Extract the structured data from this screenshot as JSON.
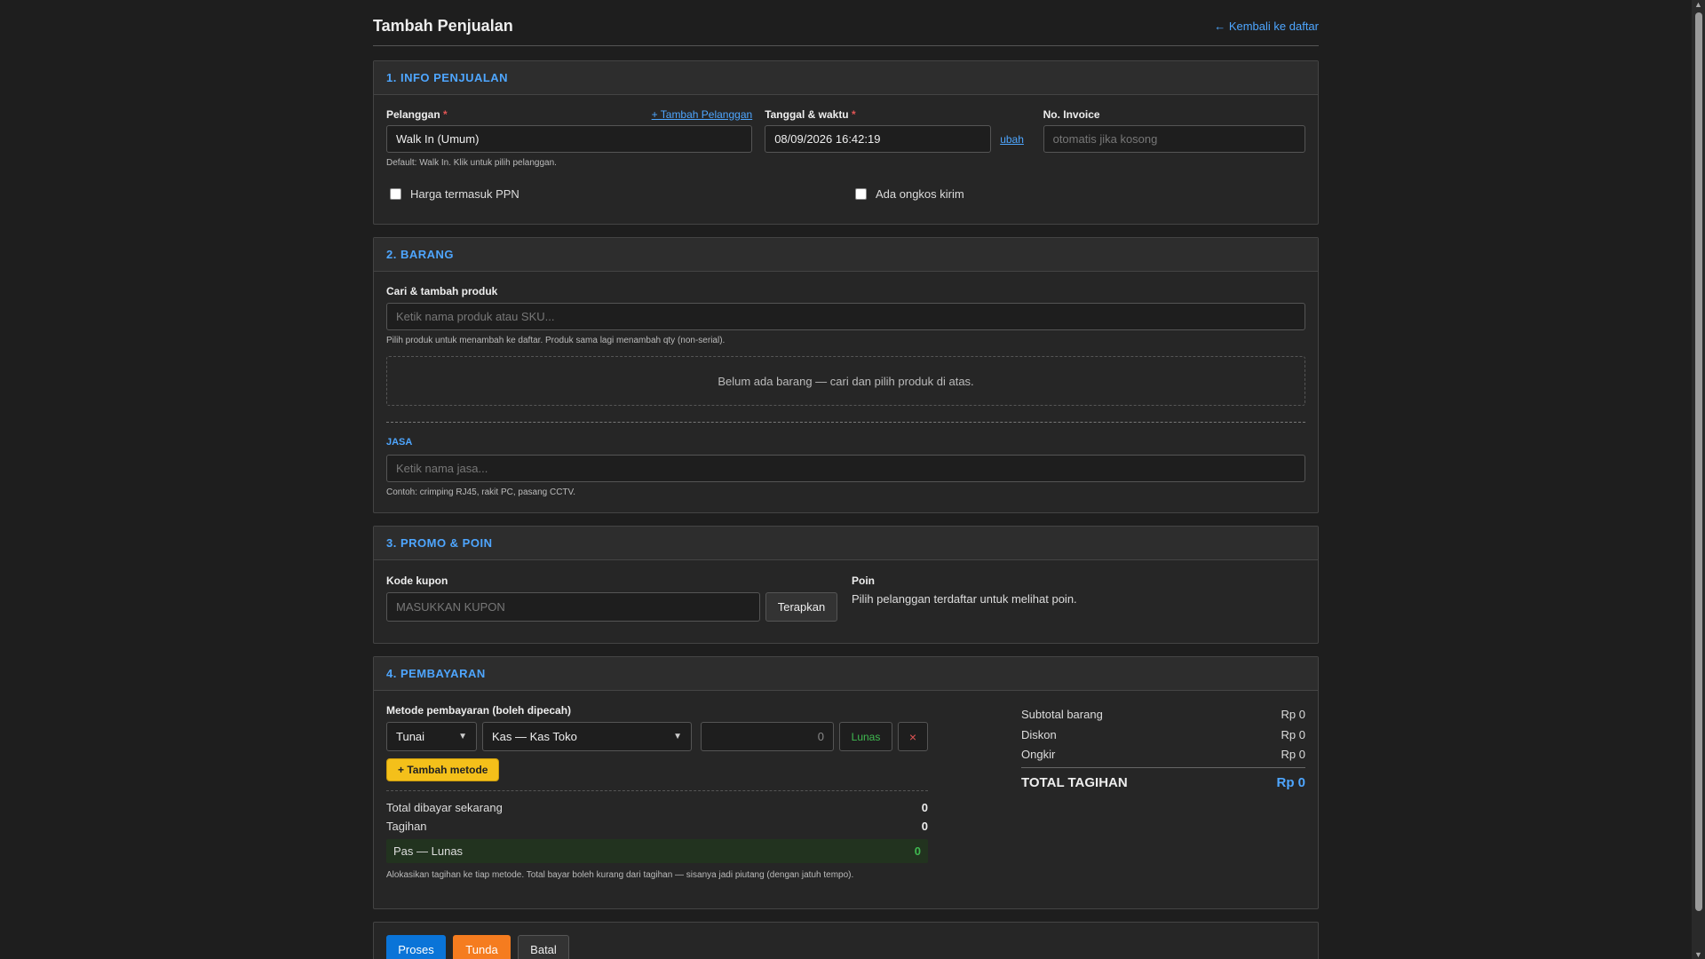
{
  "header": {
    "title": "Tambah Penjualan",
    "back_link": "← Kembali ke daftar"
  },
  "section1": {
    "title": "1. INFO PENJUALAN",
    "customer_label": "Pelanggan",
    "required_mark": "*",
    "add_customer_link": "+ Tambah Pelanggan",
    "customer_value": "Walk In (Umum)",
    "customer_hint": "Default: Walk In. Klik untuk pilih pelanggan.",
    "datetime_label": "Tanggal & waktu",
    "datetime_value": "08/09/2026 16:42:19",
    "change_link": "ubah",
    "invoice_label": "No. Invoice",
    "invoice_placeholder": "otomatis jika kosong",
    "ppn_label": "Harga termasuk PPN",
    "shipping_label": "Ada ongkos kirim"
  },
  "section2": {
    "title": "2. BARANG",
    "search_label": "Cari & tambah produk",
    "search_placeholder": "Ketik nama produk atau SKU...",
    "search_hint": "Pilih produk untuk menambah ke daftar. Produk sama lagi menambah qty (non-serial).",
    "empty_text": "Belum ada barang — cari dan pilih produk di atas.",
    "service_title": "JASA",
    "service_placeholder": "Ketik nama jasa...",
    "service_hint": "Contoh: crimping RJ45, rakit PC, pasang CCTV."
  },
  "section3": {
    "title": "3. PROMO & POIN",
    "coupon_label": "Kode kupon",
    "coupon_placeholder": "MASUKKAN KUPON",
    "apply_button": "Terapkan",
    "points_label": "Poin",
    "points_text": "Pilih pelanggan terdaftar untuk melihat poin."
  },
  "section4": {
    "title": "4. PEMBAYARAN",
    "method_label": "Metode pembayaran (boleh dipecah)",
    "method_value": "Tunai",
    "account_value": "Kas — Kas Toko",
    "amount_value": "0",
    "lunas_button": "Lunas",
    "remove_button": "×",
    "add_method_button": "+ Tambah metode",
    "paid_now_label": "Total dibayar sekarang",
    "paid_now_value": "0",
    "bill_label": "Tagihan",
    "bill_value": "0",
    "status_label": "Pas — Lunas",
    "status_value": "0",
    "alloc_hint": "Alokasikan tagihan ke tiap metode. Total bayar boleh kurang dari tagihan — sisanya jadi piutang (dengan jatuh tempo).",
    "subtotal_label": "Subtotal barang",
    "subtotal_value": "Rp 0",
    "discount_label": "Diskon",
    "discount_value": "Rp 0",
    "shipping_label": "Ongkir",
    "shipping_value": "Rp 0",
    "total_label": "TOTAL TAGIHAN",
    "total_value": "Rp 0"
  },
  "actions": {
    "process": "Proses",
    "hold": "Tunda",
    "cancel": "Batal"
  },
  "colors": {
    "accent": "#4ea6ff",
    "success": "#3fb950",
    "warning": "#f4c01a",
    "primary": "#0a74d8",
    "hold": "#f57c1f"
  }
}
